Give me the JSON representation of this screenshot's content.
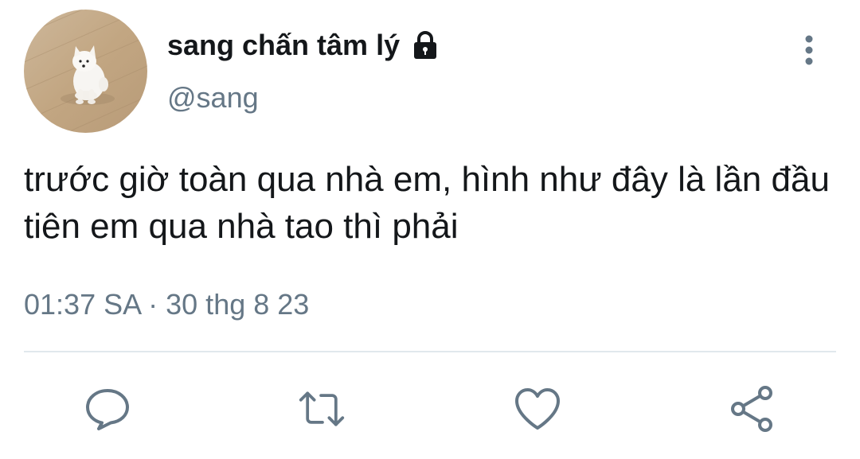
{
  "tweet": {
    "display_name": "sang chấn tâm lý",
    "handle": "@sang",
    "text": "trước giờ toàn qua nhà em, hình như đây là lần đầu tiên em qua nhà tao thì phải",
    "time": "01:37 SA",
    "separator": " · ",
    "date": "30 thg 8 23",
    "protected_icon": "lock-icon",
    "avatar": "dog-photo-avatar"
  },
  "actions": [
    "reply-icon",
    "retweet-icon",
    "like-icon",
    "share-icon"
  ],
  "menu_icon": "more-vertical-icon",
  "colors": {
    "text_primary": "#14171a",
    "text_secondary": "#657786",
    "icon": "#657786",
    "divider": "#e1e8ed"
  }
}
